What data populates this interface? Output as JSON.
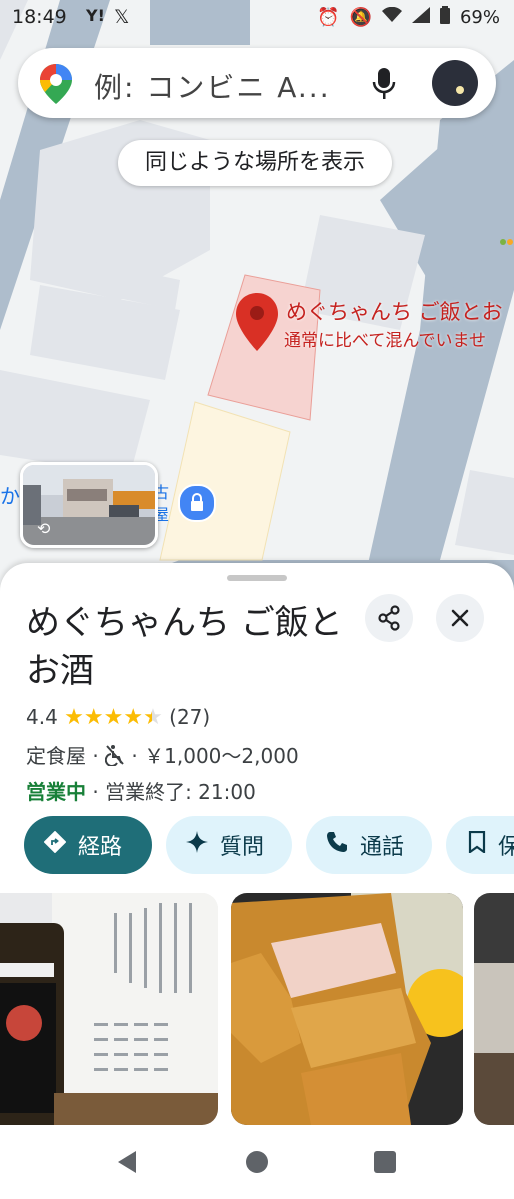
{
  "status_bar": {
    "time": "18:49",
    "left_icons": [
      "yahoo-icon",
      "x-icon"
    ],
    "battery": "69%"
  },
  "search": {
    "placeholder": "例: コンビニ A..."
  },
  "map": {
    "similar_places_chip": "同じような場所を表示",
    "pin_label_name": "めぐちゃんち ご飯とお",
    "pin_label_status": "通常に比べて混んでいませ",
    "edge_text_left": "か",
    "edge_text_right_1": "古",
    "edge_text_right_2": "屋"
  },
  "place": {
    "name": "めぐちゃんち ご飯とお酒",
    "rating": "4.4",
    "stars": 4.4,
    "review_count": "(27)",
    "category": "定食屋 · ",
    "price_sep": " · ",
    "price": "￥1,000〜2,000",
    "open_status": "営業中",
    "hours": " · 営業終了: 21:00"
  },
  "actions": {
    "directions": "経路",
    "ask": "質問",
    "call": "通話",
    "save": "保"
  },
  "colors": {
    "accent_teal": "#1f6e78",
    "open_green": "#188038",
    "pin_red": "#d93025",
    "action_bg": "#dff3fb"
  }
}
